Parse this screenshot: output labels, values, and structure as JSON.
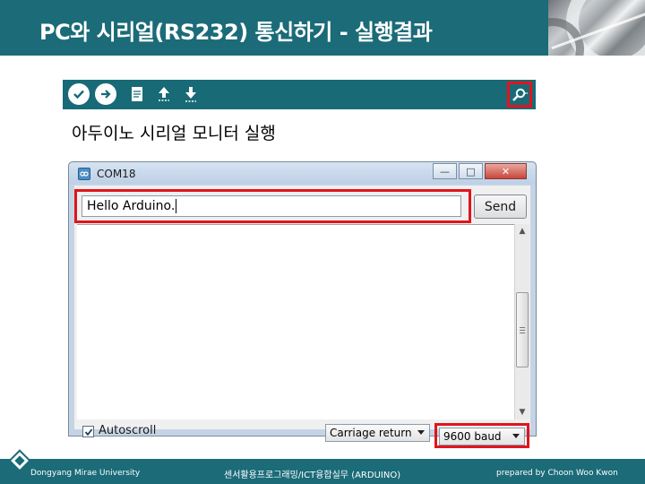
{
  "slide": {
    "title": "PC와 시리얼(RS232) 통신하기 - 실행결과",
    "caption": "아두이노 시리얼 모니터 실행"
  },
  "toolbar": {
    "buttons": [
      "verify-icon",
      "upload-icon",
      "new-icon",
      "open-icon",
      "save-icon"
    ],
    "serial_monitor_icon": "magnifier-icon",
    "colors": {
      "background": "#186a77",
      "highlight": "#e1141c"
    }
  },
  "serial_monitor": {
    "title": "COM18",
    "input_value": "Hello Arduino.",
    "send_label": "Send",
    "window_buttons": {
      "minimize": "—",
      "maximize": "□",
      "close": "✕"
    },
    "autoscroll": {
      "label": "Autoscroll",
      "checked": true
    },
    "line_ending": "Carriage return",
    "baud_rate": "9600 baud"
  },
  "footer": {
    "left": "Dongyang Mirae University",
    "center": "센서활용프로그래밍/ICT융합실무 (ARDUINO)",
    "right": "prepared by Choon Woo Kwon"
  },
  "colors": {
    "header": "#1b6b78",
    "highlight": "#e1141c"
  }
}
